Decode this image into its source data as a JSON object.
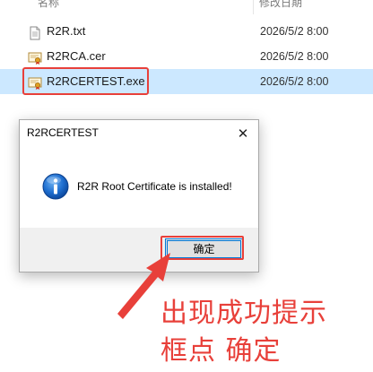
{
  "explorer": {
    "columns": {
      "name": "名称",
      "date": "修改日期"
    },
    "files": [
      {
        "name": "R2R.txt",
        "date": "2026/5/2 8:00",
        "icon": "text-file-icon"
      },
      {
        "name": "R2RCA.cer",
        "date": "2026/5/2 8:00",
        "icon": "certificate-file-icon"
      },
      {
        "name": "R2RCERTEST.exe",
        "date": "2026/5/2 8:00",
        "icon": "certificate-exe-icon",
        "selected": true
      }
    ]
  },
  "dialog": {
    "title": "R2RCERTEST",
    "close_label": "✕",
    "message": "R2R Root Certificate is installed!",
    "ok_label": "确定",
    "icon": "info-icon"
  },
  "annotation": {
    "line1": "出现成功提示",
    "line2": "框点 确定",
    "color": "#e8403a"
  },
  "colors": {
    "selection": "#cce8ff",
    "highlight": "#e8403a",
    "dialog_bg": "#f0f0f0",
    "button_border": "#0078d7"
  }
}
